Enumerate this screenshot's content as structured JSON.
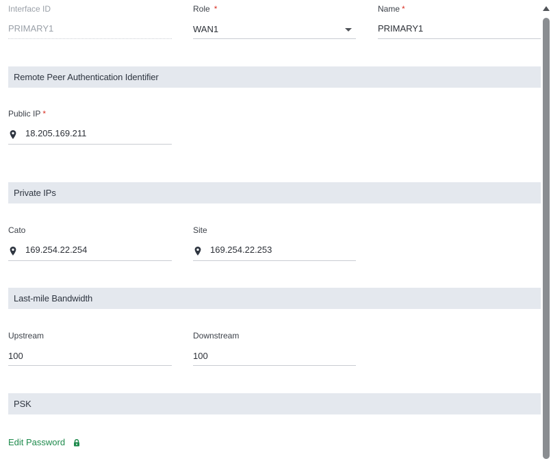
{
  "fields": {
    "interface_id": {
      "label": "Interface ID",
      "value": "PRIMARY1"
    },
    "role": {
      "label": "Role",
      "value": "WAN1"
    },
    "name": {
      "label": "Name",
      "value": "PRIMARY1"
    },
    "public_ip": {
      "label": "Public IP",
      "value": "18.205.169.211"
    },
    "cato": {
      "label": "Cato",
      "value": "169.254.22.254"
    },
    "site": {
      "label": "Site",
      "value": "169.254.22.253"
    },
    "upstream": {
      "label": "Upstream",
      "value": "100"
    },
    "downstream": {
      "label": "Downstream",
      "value": "100"
    }
  },
  "required_mark": "*",
  "sections": {
    "remote_peer": "Remote Peer Authentication Identifier",
    "private_ips": "Private IPs",
    "bandwidth": "Last-mile Bandwidth",
    "psk": "PSK"
  },
  "psk": {
    "edit_password": "Edit Password"
  },
  "colors": {
    "accent_link": "#1e8a4c",
    "required": "#d93025",
    "section_bg": "#e4e8ee"
  },
  "icons": {
    "location": "location-pin-icon",
    "lock": "lock-icon",
    "dropdown": "caret-down-icon"
  }
}
